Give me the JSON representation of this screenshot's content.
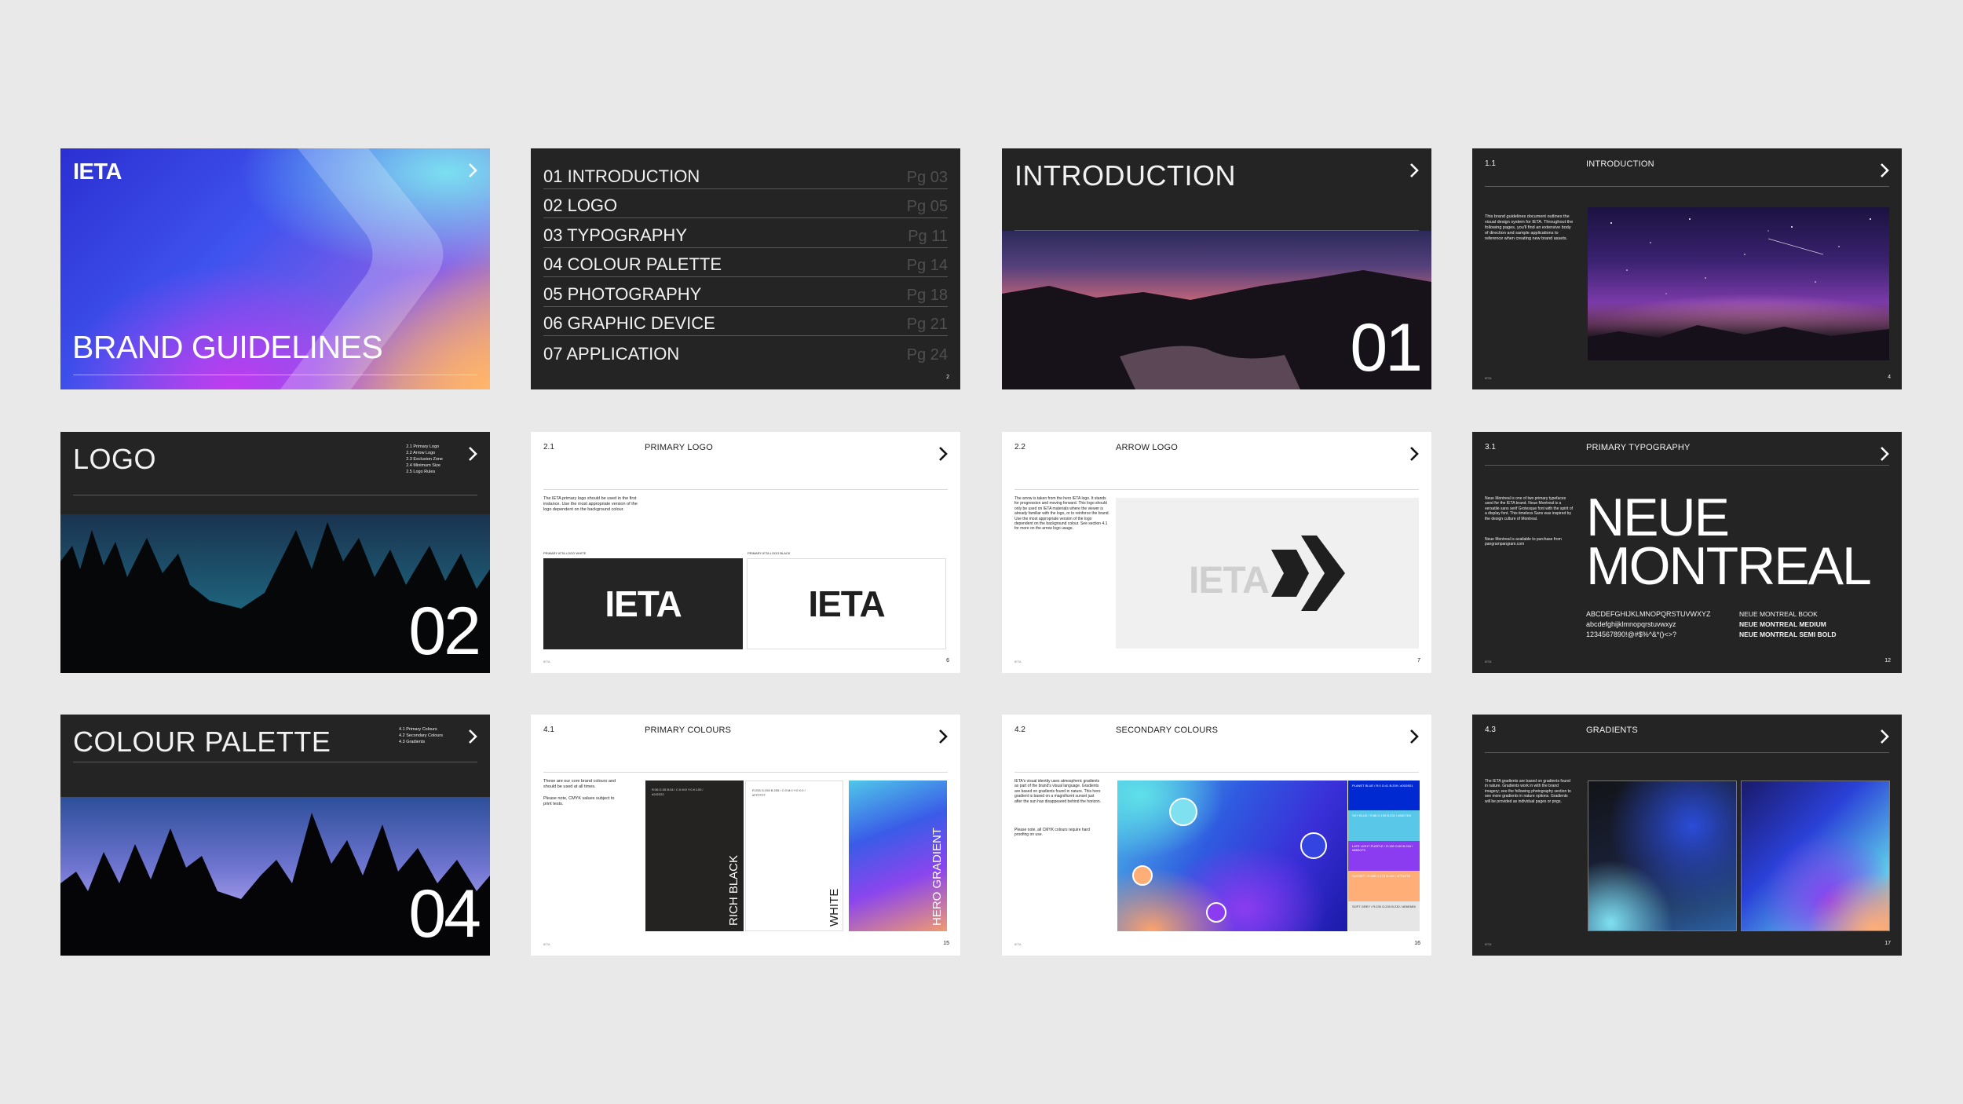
{
  "cover": {
    "logo": "IETA",
    "title": "BRAND GUIDELINES"
  },
  "toc": {
    "items": [
      {
        "label": "01 INTRODUCTION",
        "page": "Pg 03"
      },
      {
        "label": "02 LOGO",
        "page": "Pg 05"
      },
      {
        "label": "03 TYPOGRAPHY",
        "page": "Pg 11"
      },
      {
        "label": "04 COLOUR PALETTE",
        "page": "Pg 14"
      },
      {
        "label": "05 PHOTOGRAPHY",
        "page": "Pg 18"
      },
      {
        "label": "06 GRAPHIC DEVICE",
        "page": "Pg 21"
      },
      {
        "label": "07 APPLICATION",
        "page": "Pg 24"
      }
    ],
    "page_number": "2"
  },
  "intro_divider": {
    "title": "INTRODUCTION",
    "number": "01"
  },
  "intro_page": {
    "section": "1.1",
    "title": "INTRODUCTION",
    "body": "This brand guidelines document outlines the visual design system for IETA. Throughout the following pages, you'll find an extensive body of direction and sample applications to reference when creating new brand assets.",
    "page_number": "4"
  },
  "logo_divider": {
    "title": "LOGO",
    "number": "02",
    "menu": [
      "2.1 Primary Logo",
      "2.2 Arrow Logo",
      "2.3 Exclusion Zone",
      "2.4 Minimum Size",
      "2.5 Logo Rules"
    ]
  },
  "primary_logo": {
    "section": "2.1",
    "title": "PRIMARY LOGO",
    "body": "The IETA primary logo should be used in the first instance. Use the most appropriate version of the logo dependent on the background colour.",
    "label_white": "PRIMARY IETA LOGO WHITE",
    "label_black": "PRIMARY IETA LOGO BLACK",
    "logo_text": "IETA",
    "page_number": "6"
  },
  "arrow_logo": {
    "section": "2.2",
    "title": "ARROW LOGO",
    "body": "The arrow is taken from the hero IETA logo. It stands for progression and moving forward. This logo should only be used on IETA materials where the viewer is already familiar with the logo, or to reinforce the brand. Use the most appropriate version of the logo dependent on the background colour. See section 4.1 for more on the arrow logo usage.",
    "logo_text": "IETA",
    "page_number": "7"
  },
  "typography": {
    "section": "3.1",
    "title": "PRIMARY TYPOGRAPHY",
    "body": "Neue Montreal is one of two primary typefaces used for the IETA brand. Neue Montreal is a versatile sans serif Grotesque font with the spirit of a display font. This timeless Sans was inspired by the design culture of Montreal.",
    "body2": "Neue Montreal is available to purchase from pangrampangram.com",
    "font_line1": "NEUE",
    "font_line2": "MONTREAL",
    "upper": "ABCDEFGHIJKLMNOPQRSTUVWXYZ",
    "lower": "abcdefghijklmnopqrstuvwxyz",
    "digits": "1234567890!@#$%^&*()<>?",
    "weight1": "NEUE MONTREAL BOOK",
    "weight2": "NEUE MONTREAL MEDIUM",
    "weight3": "NEUE MONTREAL SEMI BOLD",
    "page_number": "12"
  },
  "palette_divider": {
    "title": "COLOUR PALETTE",
    "number": "04",
    "menu": [
      "4.1 Primary Colours",
      "4.2 Secondary Colours",
      "4.3 Gradients"
    ]
  },
  "primary_colours": {
    "section": "4.1",
    "title": "PRIMARY COLOURS",
    "body": "These are our core brand colours and should be used at all times.",
    "body2": "Please note, CMYK values subject to print tests.",
    "swatch1": "RICH BLACK",
    "swatch1_info": "R:36 G:35 B:34 / C:0 M:0 Y:0 K:100 / #242322",
    "swatch2": "WHITE",
    "swatch2_info": "R:255 G:255 B:255 / C:0 M:0 Y:0 K:0 / #FFFFFF",
    "swatch3": "HERO GRADIENT",
    "page_number": "15"
  },
  "secondary_colours": {
    "section": "4.2",
    "title": "SECONDARY COLOURS",
    "body": "IETA's visual identity uses atmospheric gradients as part of the brand's visual language. Gradients are based on gradients found in nature. This hero gradient is based on a magnificent sunset just after the sun has disappeared behind the horizon.",
    "body2": "Please note, all CMYK colours require hard proofing on use.",
    "swatches": [
      {
        "info": "PLANET BLUE / R:0 G:41 B:209 / #0029D1"
      },
      {
        "info": "SKY BLUE / R:88 G:199 B:232 / #58C7E8"
      },
      {
        "info": "LATE LIGHT PURPLE / R:139 G:60 B:240 / #8B3CF0"
      },
      {
        "info": "SUNSET / R:255 G:174 B:120 / #FFAE78"
      },
      {
        "info": "SOFT GREY / R:230 G:230 B:230 / #E6E6E6"
      }
    ],
    "page_number": "16"
  },
  "gradients": {
    "section": "4.3",
    "title": "GRADIENTS",
    "body": "The IETA gradients are based on gradients found in nature. Gradients work in with the brand imagery; see the following photography section to see more gradients in nature options. Gradients will be provided as individual pages or pngs.",
    "page_number": "17"
  },
  "colors": {
    "dark": "#252424",
    "light": "#ffffff",
    "background": "#e9e9e9"
  }
}
